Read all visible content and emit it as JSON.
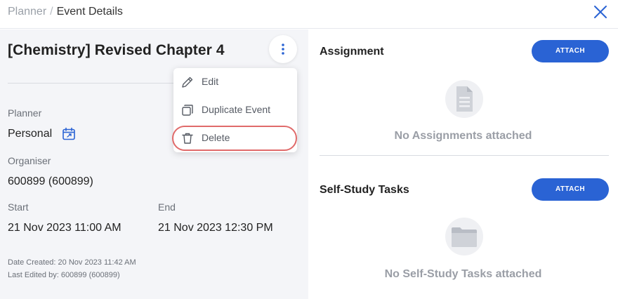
{
  "breadcrumb": {
    "parent": "Planner",
    "separator": "/",
    "current": "Event Details"
  },
  "event": {
    "title": "[Chemistry] Revised Chapter 4",
    "planner_label": "Planner",
    "planner_value": "Personal",
    "organiser_label": "Organiser",
    "organiser_value": "600899 (600899)",
    "start_label": "Start",
    "start_value": "21 Nov 2023 11:00 AM",
    "end_label": "End",
    "end_value": "21 Nov 2023 12:30 PM",
    "date_created": "Date Created: 20 Nov 2023 11:42 AM",
    "last_edited": "Last Edited by: 600899 (600899)"
  },
  "menu": {
    "items": [
      {
        "label": "Edit",
        "icon": "pencil-icon"
      },
      {
        "label": "Duplicate Event",
        "icon": "duplicate-icon"
      },
      {
        "label": "Delete",
        "icon": "trash-icon"
      }
    ]
  },
  "assignment": {
    "title": "Assignment",
    "attach_label": "ATTACH",
    "empty_text": "No Assignments attached",
    "icon": "document-icon"
  },
  "self_study": {
    "title": "Self-Study Tasks",
    "attach_label": "ATTACH",
    "empty_text": "No Self-Study Tasks attached",
    "icon": "folder-icon"
  },
  "colors": {
    "accent": "#2a63d4",
    "highlight": "#e06a6a",
    "panel_bg": "#f4f5f8"
  }
}
